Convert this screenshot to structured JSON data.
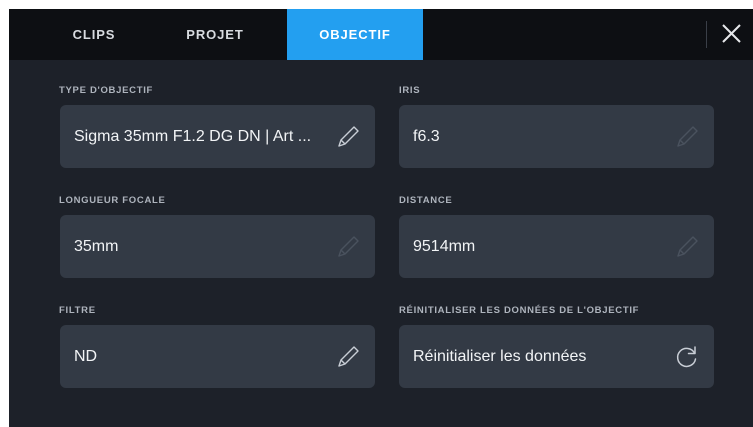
{
  "tabs": {
    "clips": "CLIPS",
    "projet": "PROJET",
    "objectif": "OBJECTIF"
  },
  "fields": {
    "lens_type": {
      "label": "TYPE D'OBJECTIF",
      "value": "Sigma 35mm F1.2 DG DN | Art ..."
    },
    "iris": {
      "label": "IRIS",
      "value": "f6.3"
    },
    "focal_length": {
      "label": "LONGUEUR FOCALE",
      "value": "35mm"
    },
    "distance": {
      "label": "DISTANCE",
      "value": "9514mm"
    },
    "filter": {
      "label": "FILTRE",
      "value": "ND"
    },
    "reset": {
      "label": "RÉINITIALISER LES DONNÉES DE L'OBJECTIF",
      "value": "Réinitialiser les données"
    }
  },
  "icons": {
    "edit": "pencil-icon",
    "reset": "refresh-icon",
    "close": "close-icon"
  },
  "colors": {
    "active_tab": "#239ff0",
    "panel_bg": "#1d2129",
    "field_bg": "#333a45",
    "topbar_bg": "#0d0f13"
  }
}
